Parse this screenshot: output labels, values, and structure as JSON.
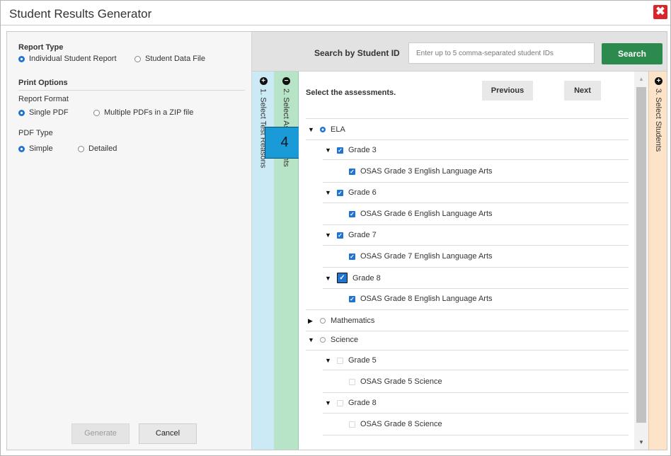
{
  "window": {
    "title": "Student Results Generator",
    "close_icon": "close-x-icon"
  },
  "report_type": {
    "title": "Report Type",
    "options": [
      "Individual Student Report",
      "Student Data File"
    ],
    "selected": "Individual Student Report"
  },
  "print_options": {
    "title": "Print Options",
    "report_format": {
      "label": "Report Format",
      "options": [
        "Single PDF",
        "Multiple PDFs in a ZIP file"
      ],
      "selected": "Single PDF"
    },
    "pdf_type": {
      "label": "PDF Type",
      "options": [
        "Simple",
        "Detailed"
      ],
      "selected": "Simple"
    }
  },
  "buttons": {
    "generate": "Generate",
    "cancel": "Cancel"
  },
  "search": {
    "label": "Search by Student ID",
    "placeholder": "Enter up to 5 comma-separated student IDs",
    "button": "Search"
  },
  "tabs": {
    "tab1": "1. Select Test Reasons",
    "tab2": "2. Select Assessments",
    "tab3": "3. Select Students"
  },
  "callout_badge": "4",
  "assessments": {
    "instruction": "Select the assessments.",
    "prev": "Previous",
    "next": "Next",
    "ela": {
      "label": "ELA",
      "grade3": "Grade 3",
      "grade3_test": "OSAS Grade 3 English Language Arts",
      "grade6": "Grade 6",
      "grade6_test": "OSAS Grade 6 English Language Arts",
      "grade7": "Grade 7",
      "grade7_test": "OSAS Grade 7 English Language Arts",
      "grade8": "Grade 8",
      "grade8_test": "OSAS Grade 8 English Language Arts"
    },
    "math": {
      "label": "Mathematics"
    },
    "science": {
      "label": "Science",
      "grade5": "Grade 5",
      "grade5_test": "OSAS Grade 5 Science",
      "grade8": "Grade 8",
      "grade8_test": "OSAS Grade 8 Science"
    }
  },
  "colors": {
    "accent": "#1f73d1",
    "search_button": "#2d8a4e",
    "close": "#d8262a"
  }
}
